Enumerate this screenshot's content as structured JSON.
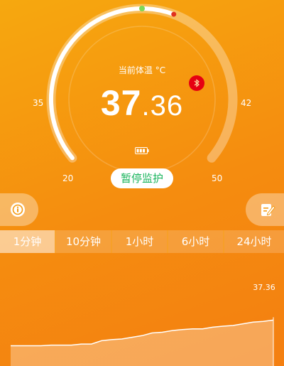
{
  "header": {
    "unit_label": "当前体温 °C",
    "temp_int": "37",
    "temp_dec": ".36"
  },
  "gauge": {
    "min": 20,
    "max": 50,
    "tick_labels": [
      "20",
      "35",
      "42",
      "50"
    ],
    "current": 37.36,
    "colors": {
      "track": "rgba(255,255,255,0.35)",
      "fill": "#ffffff",
      "low_dot": "#7ed957",
      "high_dot": "#e0301e"
    }
  },
  "bluetooth_icon": "bluetooth-icon",
  "battery_icon": "battery-icon",
  "pause_label": "暂停监护",
  "side_buttons": {
    "left_icon": "info-icon",
    "right_icon": "edit-note-icon"
  },
  "tabs": [
    {
      "label": "1分钟",
      "active": true
    },
    {
      "label": "10分钟",
      "active": false
    },
    {
      "label": "1小时",
      "active": false
    },
    {
      "label": "6小时",
      "active": false
    },
    {
      "label": "24小时",
      "active": false
    }
  ],
  "chart_data": {
    "type": "area",
    "series": [
      {
        "values": [
          36.6,
          36.6,
          36.6,
          36.6,
          36.62,
          36.62,
          36.62,
          36.65,
          36.65,
          36.75,
          36.78,
          36.8,
          36.85,
          36.9,
          36.98,
          37.0,
          37.05,
          37.08,
          37.1,
          37.1,
          37.15,
          37.18,
          37.2,
          37.25,
          37.3,
          37.32,
          37.36
        ]
      }
    ],
    "last_value_label": "37.36",
    "ylim": [
      36.0,
      38.0
    ]
  }
}
